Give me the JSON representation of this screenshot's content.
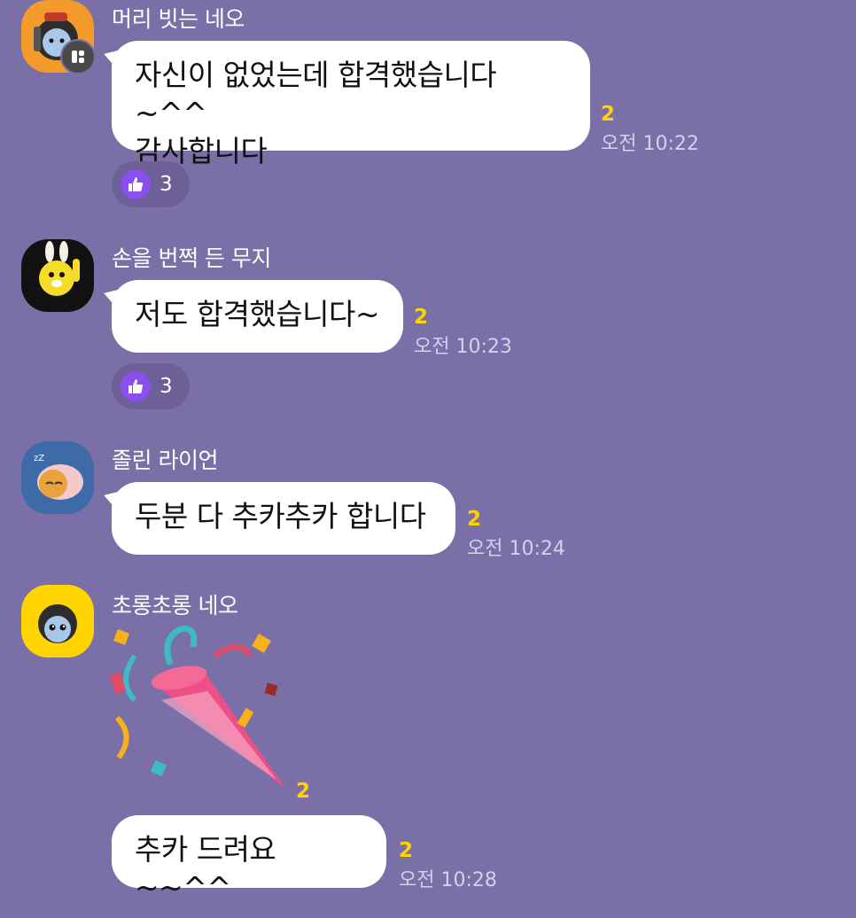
{
  "messages": [
    {
      "sender": "머리 빗는 네오",
      "avatar_icon": "neo-combing-hair-avatar-icon",
      "text": "자신이 없었는데 합격했습니다~^^\n감사합니다",
      "unread": "2",
      "time": "오전 10:22",
      "reaction": {
        "icon": "thumbs-up-icon",
        "count": "3"
      }
    },
    {
      "sender": "손을 번쩍 든 무지",
      "avatar_icon": "muzi-raising-hand-avatar-icon",
      "text": "저도 합격했습니다~",
      "unread": "2",
      "time": "오전 10:23",
      "reaction": {
        "icon": "thumbs-up-icon",
        "count": "3"
      }
    },
    {
      "sender": "졸린 라이언",
      "avatar_icon": "sleepy-ryan-avatar-icon",
      "text": "두분 다 추카추카 합니다",
      "unread": "2",
      "time": "오전 10:24"
    },
    {
      "sender": "초롱초롱 네오",
      "avatar_icon": "sparkly-neo-avatar-icon",
      "sticker": "party-popper-icon",
      "sticker_unread": "2",
      "text": "추카 드려요 ~~^^",
      "unread": "2",
      "time": "오전 10:28"
    }
  ],
  "colors": {
    "background": "#7b6fa8",
    "bubble": "#ffffff",
    "unread": "#ffd400",
    "reaction_accent": "#8b4ff0"
  }
}
